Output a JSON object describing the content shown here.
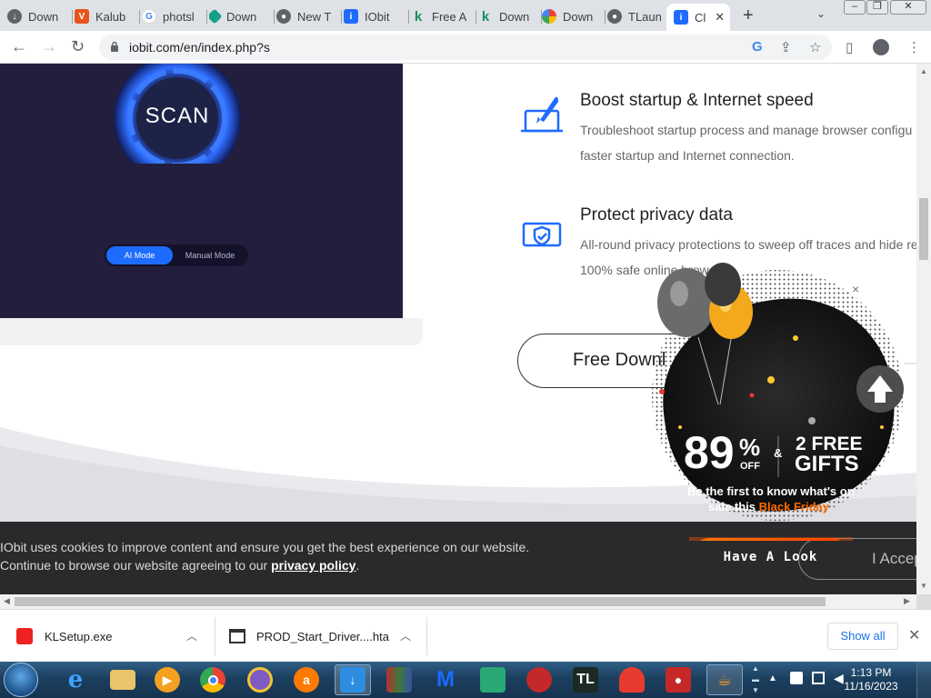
{
  "browser": {
    "tabs": [
      {
        "label": "Down",
        "icon": "chrome-downloads-icon",
        "color": "#5f6368"
      },
      {
        "label": "Kalub",
        "icon": "kalubi-icon",
        "color": "#e8541c"
      },
      {
        "label": "photsl",
        "icon": "google-icon",
        "color": "#4285f4"
      },
      {
        "label": "Down",
        "icon": "diamond-icon",
        "color": "#16a085"
      },
      {
        "label": "New T",
        "icon": "chrome-icon",
        "color": "#5f6368"
      },
      {
        "label": "IObit",
        "icon": "iobit-icon",
        "color": "#1e6bff"
      },
      {
        "label": "Free A",
        "icon": "kaspersky-icon",
        "color": "#1a8f5a"
      },
      {
        "label": "Down",
        "icon": "kaspersky-icon",
        "color": "#1a8f5a"
      },
      {
        "label": "Down",
        "icon": "photos-icon",
        "color": "#f4b400"
      },
      {
        "label": "TLaun",
        "icon": "chrome-icon",
        "color": "#5f6368"
      },
      {
        "label": "Cl",
        "icon": "iobit-icon",
        "color": "#1e6bff",
        "active": true
      }
    ],
    "url": "iobit.com/en/index.php?s"
  },
  "features": [
    {
      "title": "Boost startup & Internet speed",
      "line1": "Troubleshoot startup process and manage browser configu",
      "line2": "faster startup and Internet connection.",
      "icon": "rocket-laptop-icon"
    },
    {
      "title": "Protect privacy data",
      "line1": "All-round privacy protections to sweep off traces and hide re",
      "line2": "100% safe online brow",
      "icon": "shield-laptop-icon"
    }
  ],
  "scan": {
    "label": "SCAN",
    "mode_ai": "AI Mode",
    "mode_manual": "Manual Mode"
  },
  "download_button": "Free Downl",
  "promo": {
    "percent": "89",
    "percent_sign": "%",
    "off": "OFF",
    "amp": "&",
    "gifts_line1": "2 FREE",
    "gifts_line2": "GIFTS",
    "tagline1": "Be the first to know what's on",
    "tagline2a": "sale this",
    "tagline2b": "Black Friday",
    "cta": "Have A Look",
    "close": "×"
  },
  "cookie": {
    "line1": "IObit uses cookies to improve content and ensure you get the best experience on our website.",
    "line2_prefix": "Continue to browse our website agreeing to our ",
    "policy_link": "privacy policy",
    "line2_suffix": ".",
    "accept": "I Accep"
  },
  "downloads": [
    {
      "name": "KLSetup.exe",
      "icon": "kaspersky-file-icon"
    },
    {
      "name": "PROD_Start_Driver....hta",
      "icon": "hta-file-icon"
    }
  ],
  "downloads_show_all": "Show all",
  "taskbar": {
    "time": "1:13 PM",
    "date": "11/16/2023",
    "apps": [
      "internet-explorer",
      "file-explorer",
      "media-player",
      "chrome",
      "app-circle",
      "avast",
      "downloader",
      "winrar",
      "malwarebytes",
      "3d-box",
      "red-app",
      "tlauncher",
      "ccleaner",
      "camera-recorder",
      "java"
    ]
  }
}
